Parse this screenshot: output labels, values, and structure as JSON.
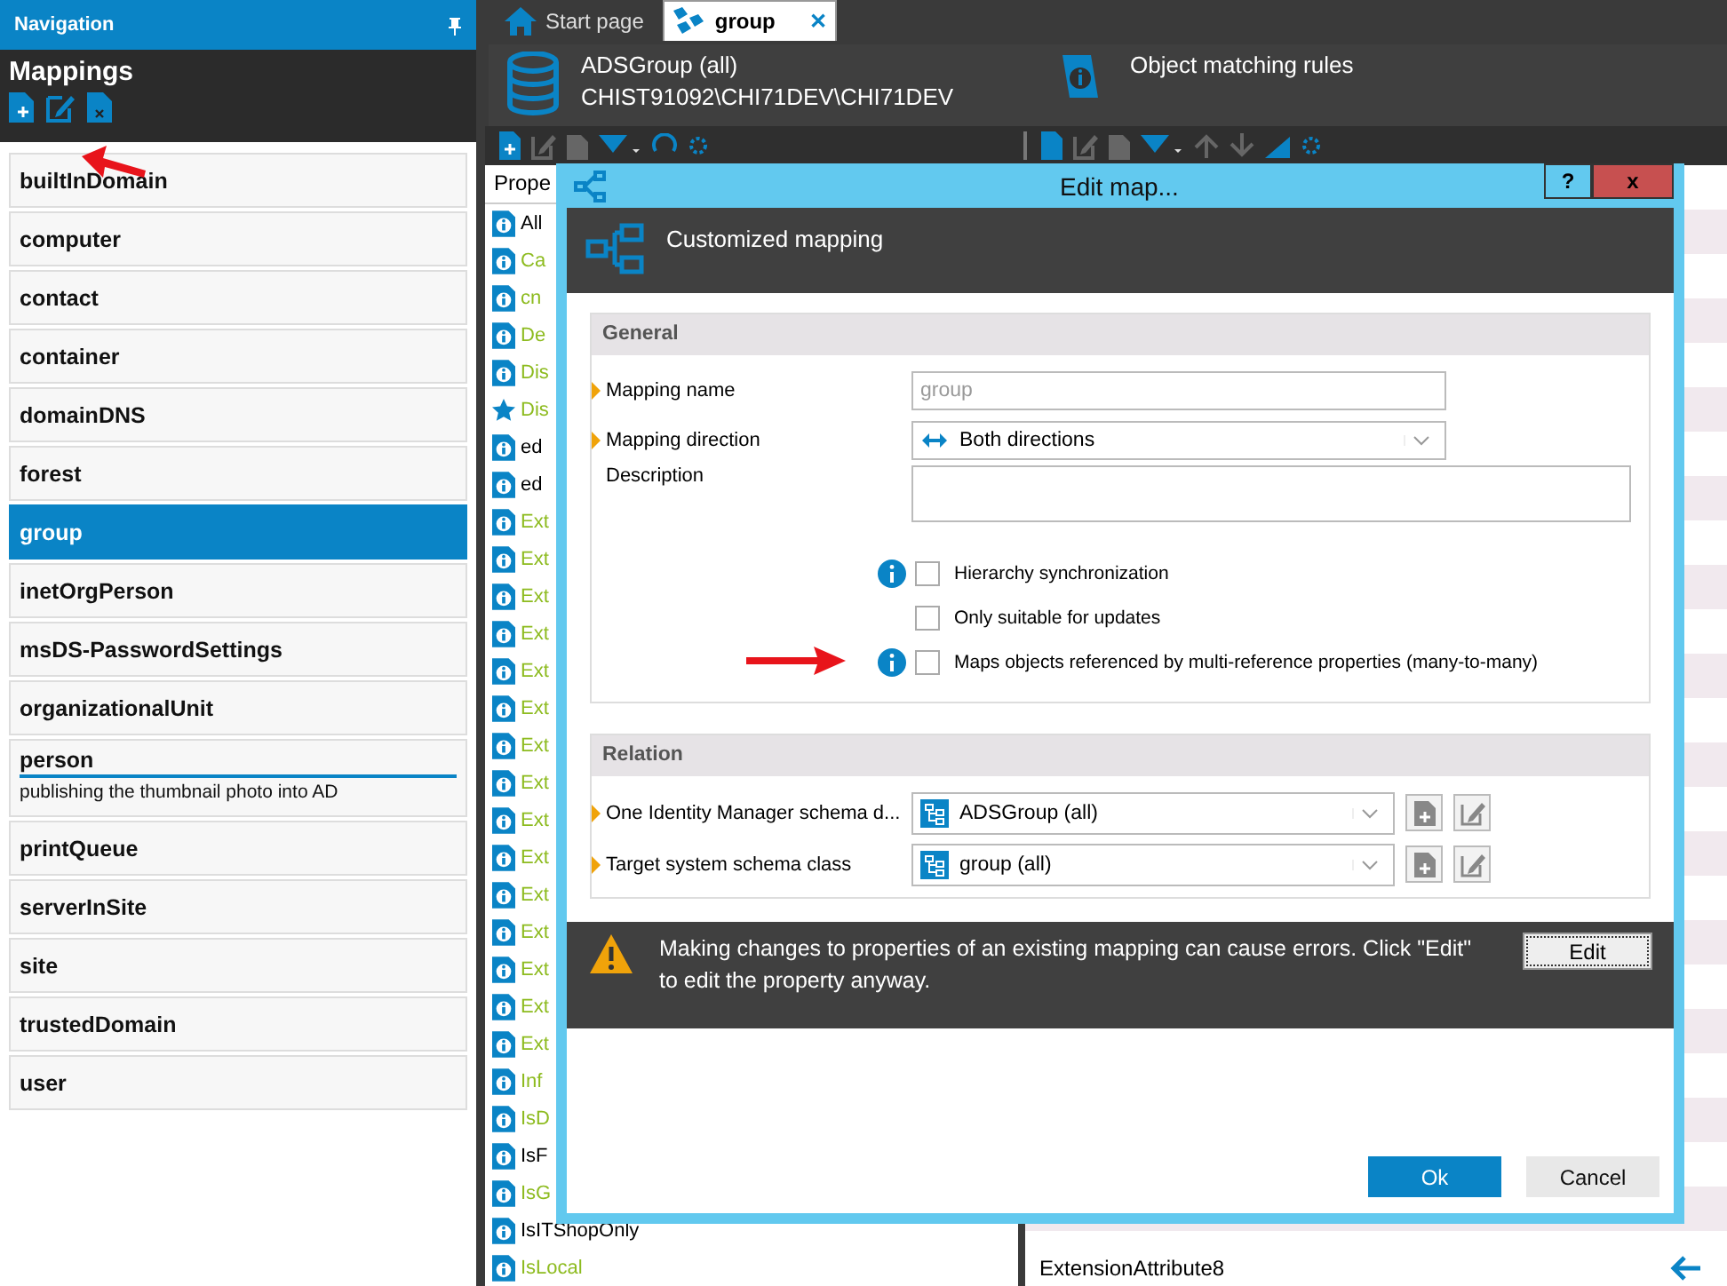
{
  "navigation": {
    "title": "Navigation",
    "heading": "Mappings",
    "items": [
      {
        "label": "builtInDomain",
        "selected": false,
        "expanded": false
      },
      {
        "label": "computer",
        "selected": false,
        "expanded": false
      },
      {
        "label": "contact",
        "selected": false,
        "expanded": false
      },
      {
        "label": "container",
        "selected": false,
        "expanded": false
      },
      {
        "label": "domainDNS",
        "selected": false,
        "expanded": false
      },
      {
        "label": "forest",
        "selected": false,
        "expanded": false
      },
      {
        "label": "group",
        "selected": true,
        "expanded": false
      },
      {
        "label": "inetOrgPerson",
        "selected": false,
        "expanded": false
      },
      {
        "label": "msDS-PasswordSettings",
        "selected": false,
        "expanded": false
      },
      {
        "label": "organizationalUnit",
        "selected": false,
        "expanded": false
      },
      {
        "label": "person",
        "selected": false,
        "expanded": true,
        "description": "publishing the thumbnail photo into AD"
      },
      {
        "label": "printQueue",
        "selected": false,
        "expanded": false
      },
      {
        "label": "serverInSite",
        "selected": false,
        "expanded": false
      },
      {
        "label": "site",
        "selected": false,
        "expanded": false
      },
      {
        "label": "trustedDomain",
        "selected": false,
        "expanded": false
      },
      {
        "label": "user",
        "selected": false,
        "expanded": false
      }
    ]
  },
  "tabs": [
    {
      "label": "Start page",
      "kind": "home",
      "selected": false
    },
    {
      "label": "group",
      "kind": "mapping",
      "selected": true,
      "close": "✕"
    }
  ],
  "object_header": {
    "title": "ADSGroup (all)",
    "path": "CHIST91092\\CHI71DEV\\CHI71DEV",
    "rules": "Object matching rules"
  },
  "properties": {
    "header": "Prope",
    "rows": [
      {
        "label": "All",
        "kind": "info",
        "color": "#000000"
      },
      {
        "label": "Ca",
        "kind": "info",
        "color": "#8dbb1f"
      },
      {
        "label": "cn",
        "kind": "info",
        "color": "#8dbb1f"
      },
      {
        "label": "De",
        "kind": "info",
        "color": "#8dbb1f"
      },
      {
        "label": "Dis",
        "kind": "info",
        "color": "#8dbb1f"
      },
      {
        "label": "Dis",
        "kind": "star",
        "color": "#8dbb1f"
      },
      {
        "label": "ed",
        "kind": "info",
        "color": "#000000"
      },
      {
        "label": "ed",
        "kind": "info",
        "color": "#000000"
      },
      {
        "label": "Ext",
        "kind": "info",
        "color": "#8dbb1f"
      },
      {
        "label": "Ext",
        "kind": "info",
        "color": "#8dbb1f"
      },
      {
        "label": "Ext",
        "kind": "info",
        "color": "#8dbb1f"
      },
      {
        "label": "Ext",
        "kind": "info",
        "color": "#8dbb1f"
      },
      {
        "label": "Ext",
        "kind": "info",
        "color": "#8dbb1f"
      },
      {
        "label": "Ext",
        "kind": "info",
        "color": "#8dbb1f"
      },
      {
        "label": "Ext",
        "kind": "info",
        "color": "#8dbb1f"
      },
      {
        "label": "Ext",
        "kind": "info",
        "color": "#8dbb1f"
      },
      {
        "label": "Ext",
        "kind": "info",
        "color": "#8dbb1f"
      },
      {
        "label": "Ext",
        "kind": "info",
        "color": "#8dbb1f"
      },
      {
        "label": "Ext",
        "kind": "info",
        "color": "#8dbb1f"
      },
      {
        "label": "Ext",
        "kind": "info",
        "color": "#8dbb1f"
      },
      {
        "label": "Ext",
        "kind": "info",
        "color": "#8dbb1f"
      },
      {
        "label": "Ext",
        "kind": "info",
        "color": "#8dbb1f"
      },
      {
        "label": "Ext",
        "kind": "info",
        "color": "#8dbb1f"
      },
      {
        "label": "Inf",
        "kind": "info",
        "color": "#8dbb1f"
      },
      {
        "label": "IsD",
        "kind": "info",
        "color": "#8dbb1f"
      },
      {
        "label": "IsF",
        "kind": "info",
        "color": "#000000"
      },
      {
        "label": "IsG",
        "kind": "info",
        "color": "#8dbb1f"
      },
      {
        "label": "IsITShopOnly",
        "kind": "info",
        "color": "#000000"
      },
      {
        "label": "IsLocal",
        "kind": "info",
        "color": "#8dbb1f"
      }
    ]
  },
  "target_rows": [
    {
      "label": "ExtensionAttribute8"
    }
  ],
  "dialog": {
    "title": "Edit map...",
    "help": "?",
    "close": "x",
    "header": "Customized mapping",
    "general": {
      "title": "General",
      "fields": [
        {
          "kind": "text",
          "label": "Mapping name",
          "required": true,
          "value": "group"
        },
        {
          "kind": "direction",
          "label": "Mapping direction",
          "required": true,
          "value": "Both directions"
        },
        {
          "kind": "textarea",
          "label": "Description",
          "required": false
        }
      ],
      "options": [
        {
          "label": "Hierarchy synchronization",
          "checked": false,
          "info": true
        },
        {
          "label": "Only suitable for updates",
          "checked": false,
          "info": false
        },
        {
          "label": "Maps objects referenced by multi-reference properties (many-to-many)",
          "checked": false,
          "info": true
        }
      ]
    },
    "relation": {
      "title": "Relation",
      "fields": [
        {
          "label": "One Identity Manager schema d...",
          "required": true,
          "value": "ADSGroup (all)"
        },
        {
          "label": "Target system schema class",
          "required": true,
          "value": "group (all)"
        }
      ]
    },
    "warning": {
      "text": "Making changes to properties of an existing mapping can cause errors. Click \"Edit\" to edit the property anyway.",
      "button": "Edit"
    },
    "buttons": [
      {
        "label": "Ok",
        "kind": "primary"
      },
      {
        "label": "Cancel",
        "kind": "secondary"
      }
    ]
  }
}
